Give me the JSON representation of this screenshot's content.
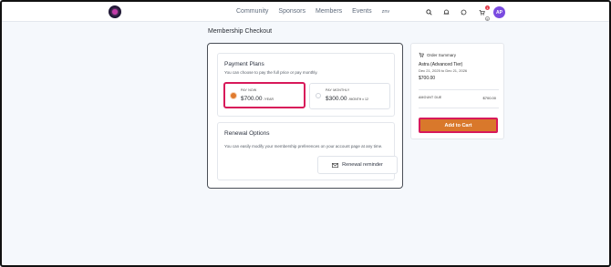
{
  "nav": {
    "links": [
      "Community",
      "Sponsors",
      "Members",
      "Events",
      "znv"
    ],
    "notification_count": "1",
    "cart_count": "0",
    "avatar_initials": "AP"
  },
  "page": {
    "title": "Membership Checkout"
  },
  "payment_plans": {
    "title": "Payment Plans",
    "subtitle": "You can choose to pay the full price or pay monthly.",
    "options": [
      {
        "label": "PAY NOW",
        "price": "$700.00",
        "unit": "/YEAR",
        "selected": true
      },
      {
        "label": "PAY MONTHLY",
        "price": "$300.00",
        "unit": "/MONTH x 12",
        "selected": false
      }
    ]
  },
  "renewal": {
    "title": "Renewal Options",
    "subtitle": "You can easily modify your membership preferences on your account page at any time.",
    "reminder_button": "Renewal reminder"
  },
  "summary": {
    "title": "Order Summary",
    "item_name": "Astra (Advanced Tier)",
    "dates": "Dec 21, 2025 to Dec 21, 2026",
    "price": "$700.00",
    "amount_due_label": "AMOUNT DUE",
    "amount_due_value": "$700.00",
    "add_button": "Add to Cart"
  },
  "colors": {
    "accent_orange": "#d9782b",
    "highlight_pink": "#d8195a",
    "avatar_purple": "#7a4be0"
  }
}
